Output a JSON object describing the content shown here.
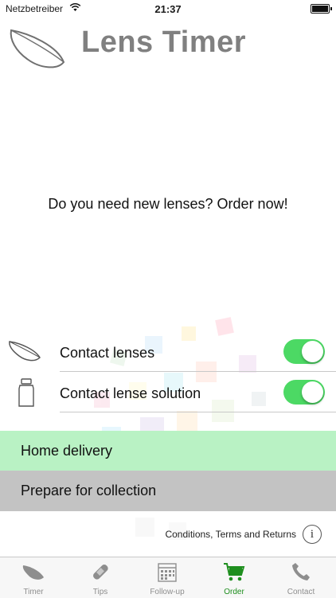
{
  "status_bar": {
    "carrier": "Netzbetreiber",
    "time": "21:37"
  },
  "header": {
    "title": "Lens Timer"
  },
  "prompt": "Do you need new lenses? Order now!",
  "options": [
    {
      "label": "Contact lenses",
      "icon": "contact-lens-icon",
      "enabled": true
    },
    {
      "label": "Contact lense solution",
      "icon": "bottle-icon",
      "enabled": true
    }
  ],
  "delivery": {
    "home_label": "Home delivery",
    "collection_label": "Prepare for collection",
    "selected": "home"
  },
  "footer": {
    "terms_label": "Conditions, Terms and Returns",
    "info_symbol": "i"
  },
  "tabs": [
    {
      "label": "Timer",
      "icon": "lens-icon"
    },
    {
      "label": "Tips",
      "icon": "bandage-icon"
    },
    {
      "label": "Follow-up",
      "icon": "calendar-icon"
    },
    {
      "label": "Order",
      "icon": "cart-icon",
      "active": true
    },
    {
      "label": "Contact",
      "icon": "phone-icon"
    }
  ],
  "colors": {
    "toggle_on": "#4cd964",
    "home_delivery_bg": "#b9f2c4",
    "collection_bg": "#c3c3c3",
    "active_tab": "#1f8f1f",
    "title_gray": "#808080"
  }
}
